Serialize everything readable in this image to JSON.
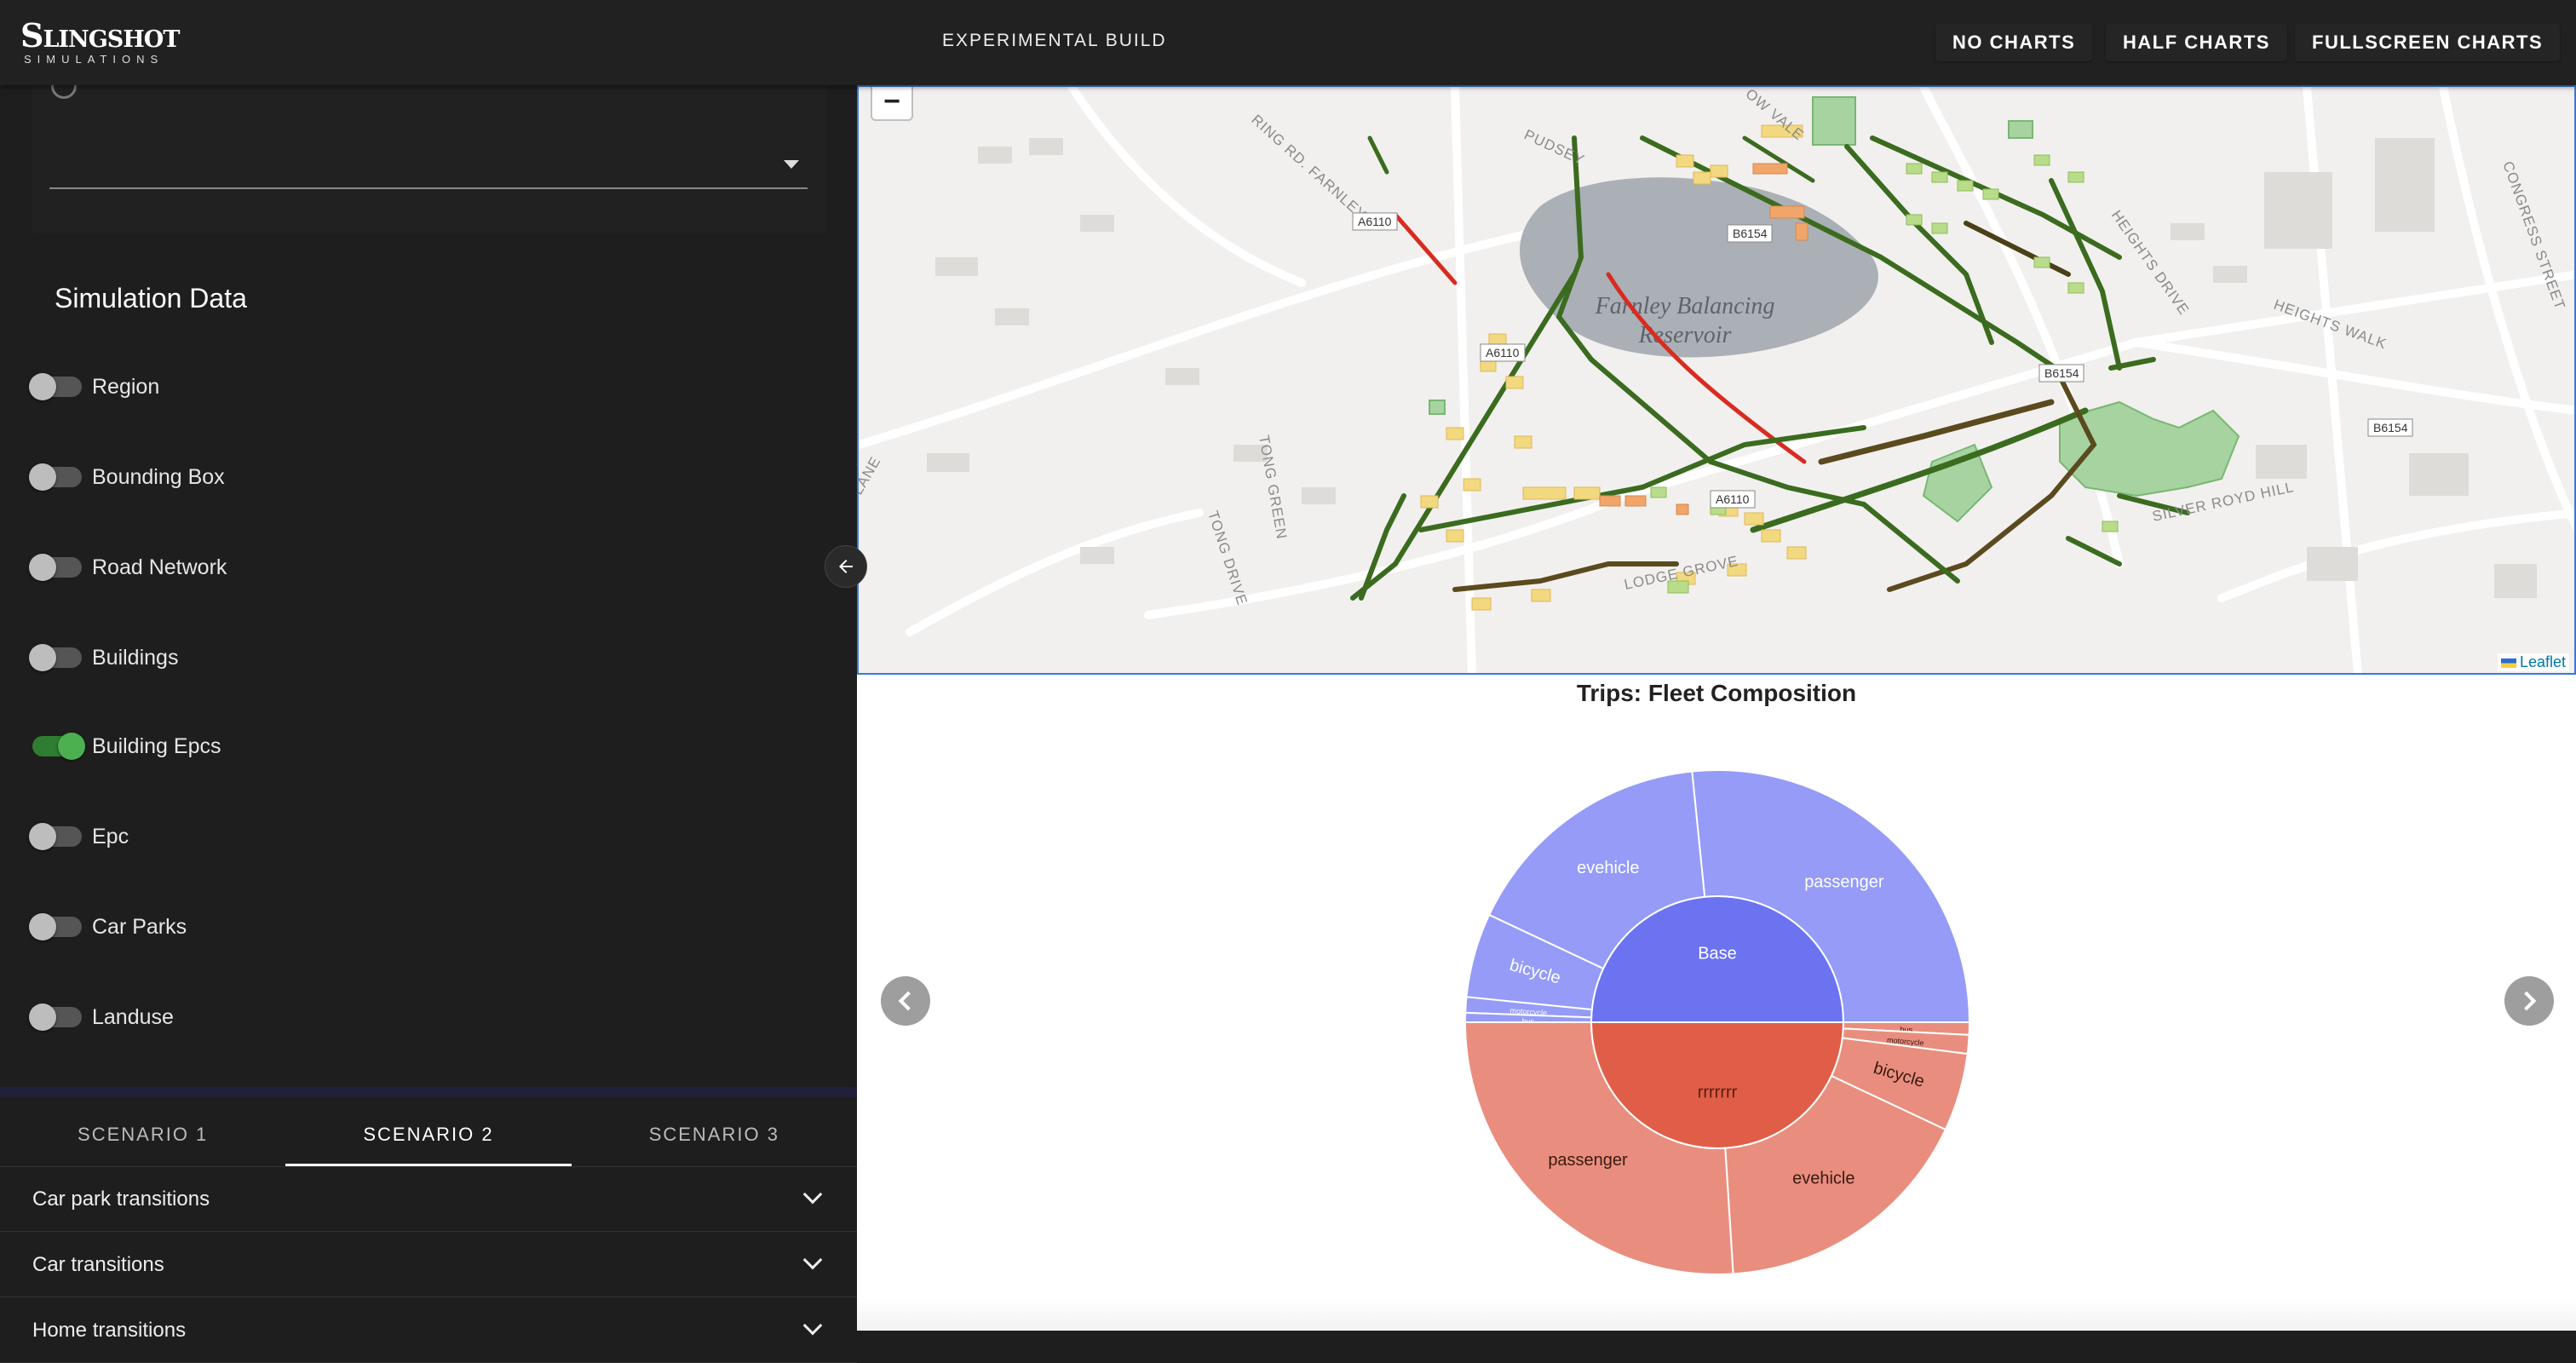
{
  "header": {
    "logo_main": "Slingshot",
    "logo_sub": "SIMULATIONS",
    "build_label": "EXPERIMENTAL BUILD",
    "buttons": [
      "NO CHARTS",
      "HALF CHARTS",
      "FULLSCREEN CHARTS"
    ]
  },
  "sidebar": {
    "section_title": "Simulation Data",
    "layers": [
      {
        "label": "Region",
        "on": false
      },
      {
        "label": "Bounding Box",
        "on": false
      },
      {
        "label": "Road Network",
        "on": false
      },
      {
        "label": "Buildings",
        "on": false
      },
      {
        "label": "Building Epcs",
        "on": true
      },
      {
        "label": "Epc",
        "on": false
      },
      {
        "label": "Car Parks",
        "on": false
      },
      {
        "label": "Landuse",
        "on": false
      }
    ],
    "scenario_tabs": [
      "SCENARIO 1",
      "SCENARIO 2",
      "SCENARIO 3"
    ],
    "active_tab": "SCENARIO 2",
    "accordions": [
      "Car park transitions",
      "Car transitions",
      "Home transitions"
    ]
  },
  "map": {
    "zoom_out_label": "−",
    "attribution": "Leaflet",
    "labels": {
      "reservoir": [
        "Farnley Balancing",
        "Reservoir"
      ],
      "roads": [
        "PUDSEY",
        "RING RD. FARNLEY",
        "TONG GREEN",
        "TONG DRIVE",
        "SILVER ROYD HILL",
        "HEIGHTS DRIVE",
        "HEIGHTS WALK",
        "CONGRESS STREET",
        "OW VALE",
        "LODGE GROVE",
        "LANE"
      ],
      "shields": [
        "A6110",
        "A6110",
        "B6154",
        "B6154",
        "B6154",
        "A6110"
      ]
    }
  },
  "chart_data": {
    "type": "sunburst",
    "title": "Trips: Fleet Composition",
    "inner": [
      {
        "label": "Base",
        "value": 50,
        "color": "#6b73f0"
      },
      {
        "label": "rrrrrrr",
        "value": 50,
        "color": "#e05e48"
      }
    ],
    "outer": [
      {
        "parent": "Base",
        "label": "passenger",
        "value": 26.6,
        "color": "#959bf6"
      },
      {
        "parent": "Base",
        "label": "evehicle",
        "value": 16.4,
        "color": "#959bf6"
      },
      {
        "parent": "Base",
        "label": "bicycle",
        "value": 5.4,
        "color": "#959bf6"
      },
      {
        "parent": "Base",
        "label": "motorcycle",
        "value": 1.0,
        "color": "#959bf6"
      },
      {
        "parent": "Base",
        "label": "bus",
        "value": 0.6,
        "color": "#959bf6"
      },
      {
        "parent": "rrrrrrr",
        "label": "bus",
        "value": 0.8,
        "color": "#e98e7e"
      },
      {
        "parent": "rrrrrrr",
        "label": "motorcycle",
        "value": 1.2,
        "color": "#e98e7e"
      },
      {
        "parent": "rrrrrrr",
        "label": "bicycle",
        "value": 5.0,
        "color": "#e98e7e"
      },
      {
        "parent": "rrrrrrr",
        "label": "evehicle",
        "value": 17.0,
        "color": "#e98e7e"
      },
      {
        "parent": "rrrrrrr",
        "label": "passenger",
        "value": 26.0,
        "color": "#e98e7e"
      }
    ]
  }
}
